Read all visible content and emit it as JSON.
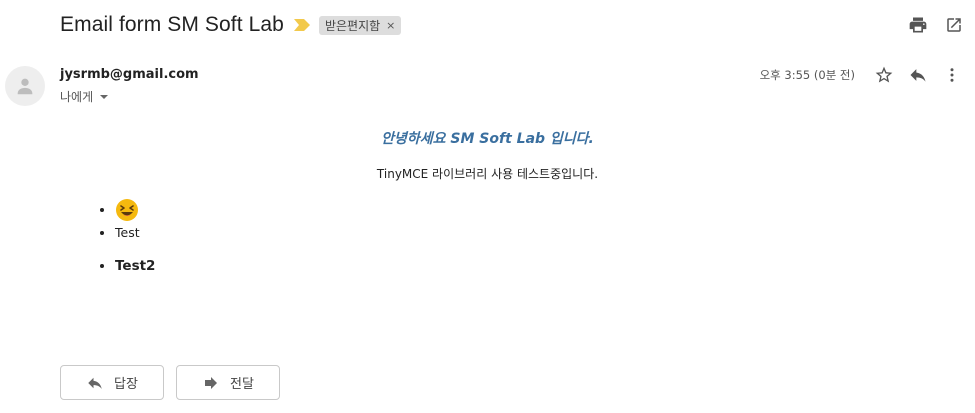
{
  "email": {
    "subject": "Email form SM Soft Lab",
    "label": "받은편지함",
    "label_remove": "×",
    "sender": "jysrmb@gmail.com",
    "recipient": "나에게",
    "timestamp": "오후 3:55 (0분 전)"
  },
  "body": {
    "greeting": "안녕하세요 SM Soft Lab 입니다.",
    "description": "TinyMCE 라이브러리 사용 테스트중입니다.",
    "list1": [
      "Test"
    ],
    "list2": [
      "Test2"
    ]
  },
  "actions": {
    "reply": "답장",
    "forward": "전달"
  },
  "colors": {
    "greeting": "#3a6f9f",
    "importance_marker": "#f2c94c",
    "emoji": "#f5b90f"
  },
  "icons": [
    "print-icon",
    "open-in-new-window-icon",
    "star-icon",
    "reply-icon",
    "more-vert-icon",
    "forward-icon",
    "chevron-down-icon",
    "importance-marker-icon",
    "avatar-person-icon",
    "laughing-emoji-icon"
  ]
}
